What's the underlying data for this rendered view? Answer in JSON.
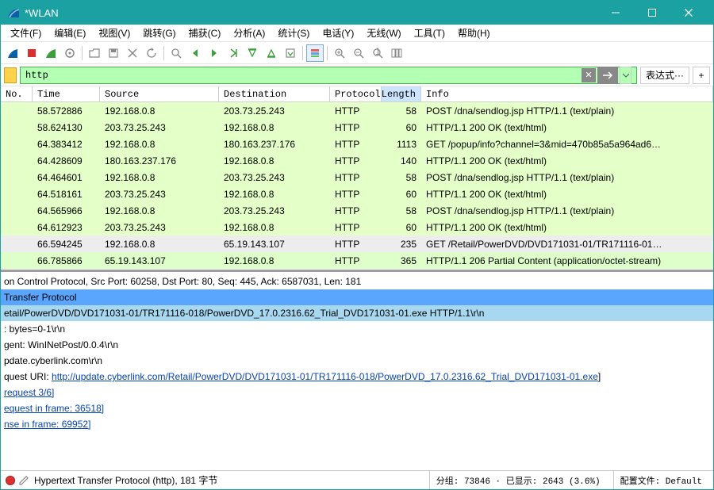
{
  "title": "*WLAN",
  "menus": [
    "文件(F)",
    "编辑(E)",
    "视图(V)",
    "跳转(G)",
    "捕获(C)",
    "分析(A)",
    "统计(S)",
    "电话(Y)",
    "无线(W)",
    "工具(T)",
    "帮助(H)"
  ],
  "filter": {
    "value": "http",
    "expr_label": "表达式···"
  },
  "columns": {
    "no": "No.",
    "time": "Time",
    "src": "Source",
    "dst": "Destination",
    "proto": "Protocol",
    "len": "Length",
    "info": "Info"
  },
  "packets": [
    {
      "no": "",
      "time": "58.572886",
      "src": "192.168.0.8",
      "dst": "203.73.25.243",
      "proto": "HTTP",
      "len": "58",
      "info": "POST /dna/sendlog.jsp HTTP/1.1  (text/plain)",
      "cls": "green"
    },
    {
      "no": "",
      "time": "58.624130",
      "src": "203.73.25.243",
      "dst": "192.168.0.8",
      "proto": "HTTP",
      "len": "60",
      "info": "HTTP/1.1 200 OK  (text/html)",
      "cls": "green"
    },
    {
      "no": "",
      "time": "64.383412",
      "src": "192.168.0.8",
      "dst": "180.163.237.176",
      "proto": "HTTP",
      "len": "1113",
      "info": "GET /popup/info?channel=3&mid=470b85a5a964ad6…",
      "cls": "green"
    },
    {
      "no": "",
      "time": "64.428609",
      "src": "180.163.237.176",
      "dst": "192.168.0.8",
      "proto": "HTTP",
      "len": "140",
      "info": "HTTP/1.1 200 OK  (text/html)",
      "cls": "green"
    },
    {
      "no": "",
      "time": "64.464601",
      "src": "192.168.0.8",
      "dst": "203.73.25.243",
      "proto": "HTTP",
      "len": "58",
      "info": "POST /dna/sendlog.jsp HTTP/1.1  (text/plain)",
      "cls": "green"
    },
    {
      "no": "",
      "time": "64.518161",
      "src": "203.73.25.243",
      "dst": "192.168.0.8",
      "proto": "HTTP",
      "len": "60",
      "info": "HTTP/1.1 200 OK  (text/html)",
      "cls": "green"
    },
    {
      "no": "",
      "time": "64.565966",
      "src": "192.168.0.8",
      "dst": "203.73.25.243",
      "proto": "HTTP",
      "len": "58",
      "info": "POST /dna/sendlog.jsp HTTP/1.1  (text/plain)",
      "cls": "green"
    },
    {
      "no": "",
      "time": "64.612923",
      "src": "203.73.25.243",
      "dst": "192.168.0.8",
      "proto": "HTTP",
      "len": "60",
      "info": "HTTP/1.1 200 OK  (text/html)",
      "cls": "green"
    },
    {
      "no": "",
      "time": "66.594245",
      "src": "192.168.0.8",
      "dst": "65.19.143.107",
      "proto": "HTTP",
      "len": "235",
      "info": "GET /Retail/PowerDVD/DVD171031-01/TR171116-01…",
      "cls": "sel",
      "arrow": true
    },
    {
      "no": "",
      "time": "66.785866",
      "src": "65.19.143.107",
      "dst": "192.168.0.8",
      "proto": "HTTP",
      "len": "365",
      "info": "HTTP/1.1 206 Partial Content  (application/octet-stream)",
      "cls": "sel2",
      "arrow": true
    }
  ],
  "details": {
    "l0": "on Control Protocol, Src Port: 60258, Dst Port: 80, Seq: 445, Ack: 6587031, Len: 181",
    "l1": "Transfer Protocol",
    "l2": "etail/PowerDVD/DVD171031-01/TR171116-018/PowerDVD_17.0.2316.62_Trial_DVD171031-01.exe HTTP/1.1\\r\\n",
    "l3": ": bytes=0-1\\r\\n",
    "l4": "gent: WinINetPost/0.0.4\\r\\n",
    "l5": "pdate.cyberlink.com\\r\\n",
    "l6": "",
    "l7_pre": "quest URI: ",
    "l7_link": "http://update.cyberlink.com/Retail/PowerDVD/DVD171031-01/TR171116-018/PowerDVD_17.0.2316.62_Trial_DVD171031-01.exe",
    "l7_post": "]",
    "l8": "request 3/6]",
    "l9": "equest in frame: 36518]",
    "l10": "nse in frame: 69952]"
  },
  "status": {
    "left": "Hypertext Transfer Protocol (http), 181 字节",
    "mid": "分组: 73846 · 已显示: 2643 (3.6%)",
    "right": "配置文件: Default"
  }
}
